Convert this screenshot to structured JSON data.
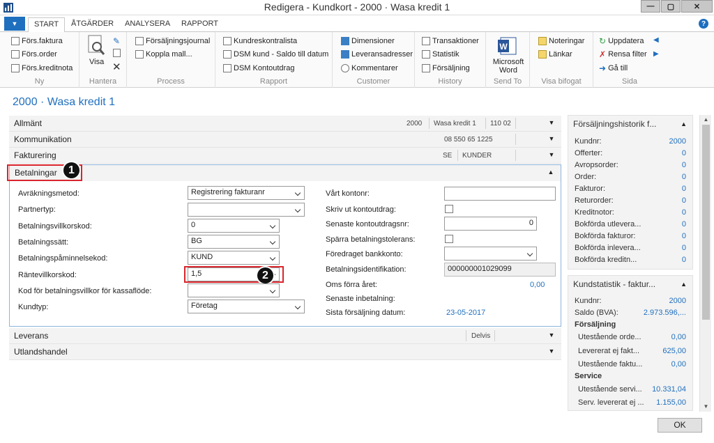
{
  "window": {
    "title": "Redigera - Kundkort - 2000 · Wasa kredit 1",
    "minimize": "—",
    "maximize": "▢",
    "close": "✕"
  },
  "tabs": [
    "START",
    "ÅTGÄRDER",
    "ANALYSERA",
    "RAPPORT"
  ],
  "ribbon": {
    "ny": {
      "label": "Ny",
      "items": [
        "Förs.faktura",
        "Förs.order",
        "Förs.kreditnota"
      ]
    },
    "hantera": {
      "label": "Hantera",
      "visa": "Visa"
    },
    "process": {
      "label": "Process",
      "items": [
        "Försäljningsjournal",
        "Koppla mall..."
      ]
    },
    "rapport": {
      "label": "Rapport",
      "items": [
        "Kundreskontralista",
        "DSM kund - Saldo till datum",
        "DSM Kontoutdrag"
      ]
    },
    "customer": {
      "label": "Customer",
      "items": [
        "Dimensioner",
        "Leveransadresser",
        "Kommentarer"
      ]
    },
    "history": {
      "label": "History",
      "items": [
        "Transaktioner",
        "Statistik",
        "Försäljning"
      ]
    },
    "sendto": {
      "label": "Send To",
      "word": "Microsoft Word"
    },
    "visabifogat": {
      "label": "Visa bifogat",
      "items": [
        "Noteringar",
        "Länkar"
      ]
    },
    "sida": {
      "label": "Sida",
      "items": [
        "Uppdatera",
        "Rensa filter",
        "Gå till"
      ]
    }
  },
  "page_title": "2000 · Wasa kredit 1",
  "fasttabs": {
    "allmant": {
      "label": "Allmänt",
      "s1": "2000",
      "s2": "Wasa kredit 1",
      "s3": "110 02"
    },
    "kommunikation": {
      "label": "Kommunikation",
      "s1": "08 550 65 1225"
    },
    "fakturering": {
      "label": "Fakturering",
      "s1": "SE",
      "s2": "KUNDER"
    },
    "betalningar": {
      "label": "Betalningar"
    },
    "leverans": {
      "label": "Leverans",
      "s1": "Delvis"
    },
    "utlandshandel": {
      "label": "Utlandshandel"
    }
  },
  "betalningar": {
    "left": [
      {
        "label": "Avräkningsmetod:",
        "value": "Registrering fakturanr"
      },
      {
        "label": "Partnertyp:",
        "value": ""
      },
      {
        "label": "Betalningsvillkorskod:",
        "value": "0"
      },
      {
        "label": "Betalningssätt:",
        "value": "BG"
      },
      {
        "label": "Betalningspåminnelsekod:",
        "value": "KUND"
      },
      {
        "label": "Räntevillkorskod:",
        "value": "1,5"
      },
      {
        "label": "Kod för betalningsvillkor för kassaflöde:",
        "value": ""
      },
      {
        "label": "Kundtyp:",
        "value": "Företag"
      }
    ],
    "right": [
      {
        "label": "Vårt kontonr:",
        "value": ""
      },
      {
        "label": "Skriv ut kontoutdrag:",
        "value": ""
      },
      {
        "label": "Senaste kontoutdragsnr:",
        "value": "0"
      },
      {
        "label": "Spärra betalningstolerans:",
        "value": ""
      },
      {
        "label": "Föredraget bankkonto:",
        "value": ""
      },
      {
        "label": "Betalningsidentifikation:",
        "value": "000000001029099"
      },
      {
        "label": "Oms förra året:",
        "value": "0,00"
      },
      {
        "label": "Senaste inbetalning:",
        "value": ""
      },
      {
        "label": "Sista försäljning datum:",
        "value": "23-05-2017"
      }
    ]
  },
  "markers": [
    "1",
    "2"
  ],
  "side1": {
    "title": "Försäljningshistorik f...",
    "rows": [
      {
        "label": "Kundnr:",
        "value": "2000"
      },
      {
        "label": "Offerter:",
        "value": "0"
      },
      {
        "label": "Avropsorder:",
        "value": "0"
      },
      {
        "label": "Order:",
        "value": "0"
      },
      {
        "label": "Fakturor:",
        "value": "0"
      },
      {
        "label": "Returorder:",
        "value": "0"
      },
      {
        "label": "Kreditnotor:",
        "value": "0"
      },
      {
        "label": "Bokförda utlevera...",
        "value": "0"
      },
      {
        "label": "Bokförda fakturor:",
        "value": "0"
      },
      {
        "label": "Bokförda inlevera...",
        "value": "0"
      },
      {
        "label": "Bokförda kreditn...",
        "value": "0"
      }
    ]
  },
  "side2": {
    "title": "Kundstatistik - faktur...",
    "kundnr_label": "Kundnr:",
    "kundnr": "2000",
    "saldo_label": "Saldo (BVA):",
    "saldo": "2.973.596,...",
    "forsaljning": "Försäljning",
    "rows1": [
      {
        "label": "Utestående orde...",
        "value": "0,00"
      },
      {
        "label": "Levererat ej fakt...",
        "value": "625,00"
      },
      {
        "label": "Utestående faktu...",
        "value": "0,00"
      }
    ],
    "service": "Service",
    "rows2": [
      {
        "label": "Utestående servi...",
        "value": "10.331,04"
      },
      {
        "label": "Serv. levererat ej ...",
        "value": "1.155,00"
      }
    ]
  },
  "ok": "OK",
  "help": "?",
  "colors": {
    "accent": "#1f6fbf",
    "highlight": "#d9252c",
    "panel": "#f3f3f3"
  }
}
